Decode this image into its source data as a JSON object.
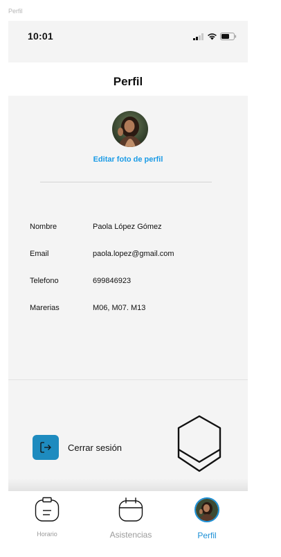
{
  "frame_label": "Perfil",
  "status_bar": {
    "time": "10:01"
  },
  "header": {
    "title": "Perfil"
  },
  "profile": {
    "edit_photo_label": "Editar foto de perfil"
  },
  "fields": [
    {
      "label": "Nombre",
      "value": "Paola López Gómez"
    },
    {
      "label": "Email",
      "value": "paola.lopez@gmail.com"
    },
    {
      "label": "Telefono",
      "value": "699846923"
    },
    {
      "label": "Marerias",
      "value": "M06,  M07. M13"
    }
  ],
  "logout": {
    "label": "Cerrar sesión"
  },
  "bottom_nav": {
    "items": [
      {
        "label": "Horario",
        "icon": "schedule-icon",
        "active": false
      },
      {
        "label": "Asistencias",
        "icon": "calendar-icon",
        "active": false
      },
      {
        "label": "Perfil",
        "icon": "avatar",
        "active": true
      }
    ]
  },
  "colors": {
    "accent": "#1a9be6",
    "logout_button": "#1e8bbf",
    "background": "#f4f4f4",
    "inactive_nav": "#9a9a9a"
  }
}
